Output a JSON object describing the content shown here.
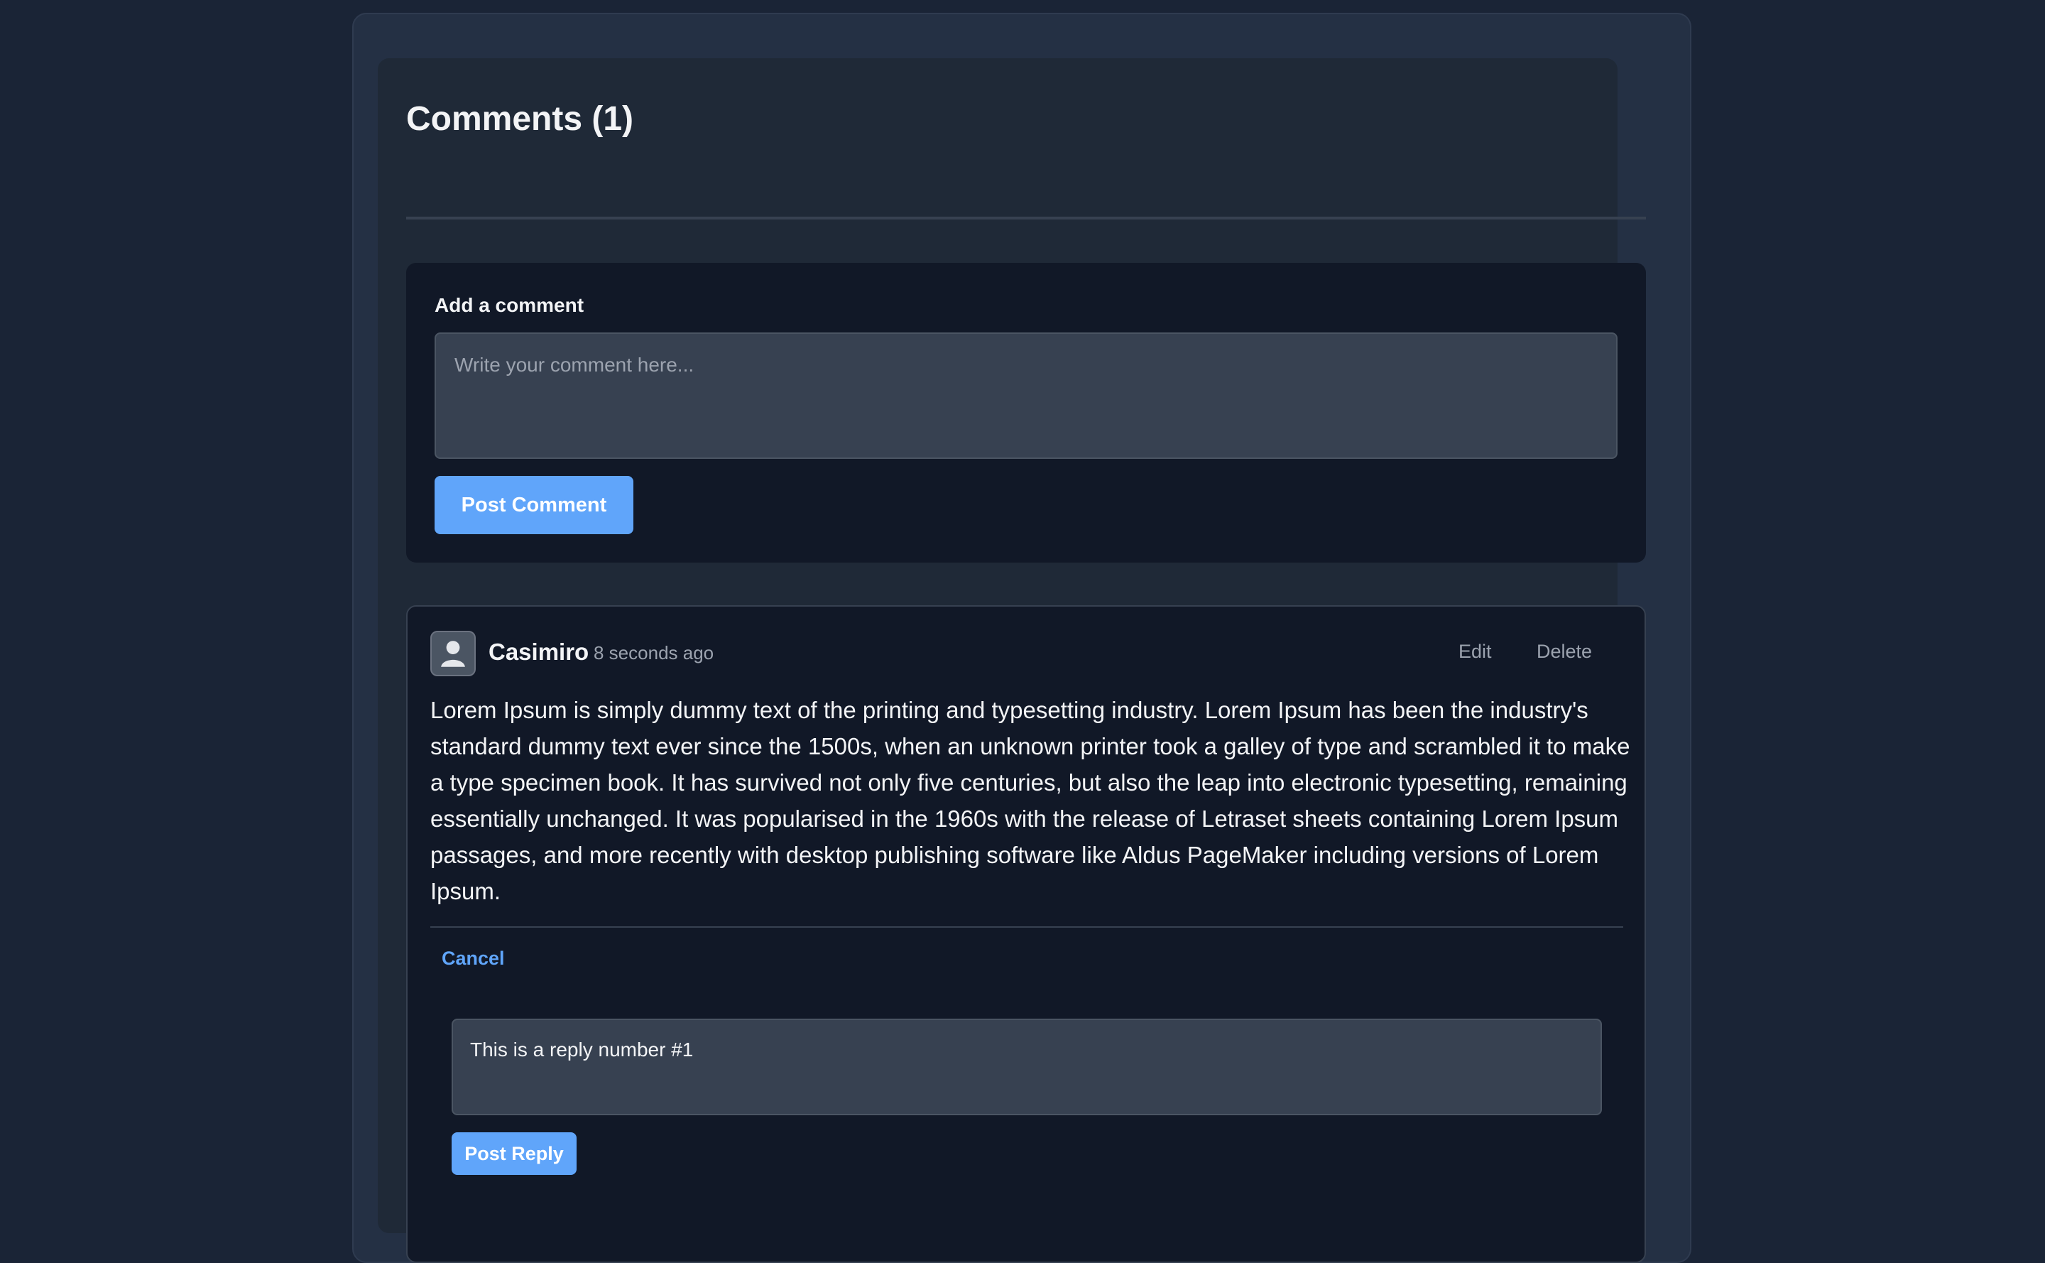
{
  "comments": {
    "title": "Comments (1)"
  },
  "add_comment": {
    "label": "Add a comment",
    "placeholder": "Write your comment here...",
    "value": "",
    "submit_label": "Post Comment"
  },
  "comment": {
    "avatar_icon": "user-icon",
    "author": "Casimiro",
    "timestamp": "8 seconds ago",
    "edit_label": "Edit",
    "delete_label": "Delete",
    "body": "Lorem Ipsum is simply dummy text of the printing and typesetting industry. Lorem Ipsum has been the industry's standard dummy text ever since the 1500s, when an unknown printer took a galley of type and scrambled it to make a type specimen book. It has survived not only five centuries, but also the leap into electronic typesetting, remaining essentially unchanged. It was popularised in the 1960s with the release of Letraset sheets containing Lorem Ipsum passages, and more recently with desktop publishing software like Aldus PageMaker including versions of Lorem Ipsum."
  },
  "reply": {
    "cancel_label": "Cancel",
    "value": "This is a reply number #1",
    "submit_label": "Post Reply"
  },
  "colors": {
    "page_background": "#1a2436",
    "panel": "#243044",
    "card": "#1f2937",
    "inner_box": "#111827",
    "accent": "#60a5fa",
    "muted_text": "#9ca3af"
  }
}
